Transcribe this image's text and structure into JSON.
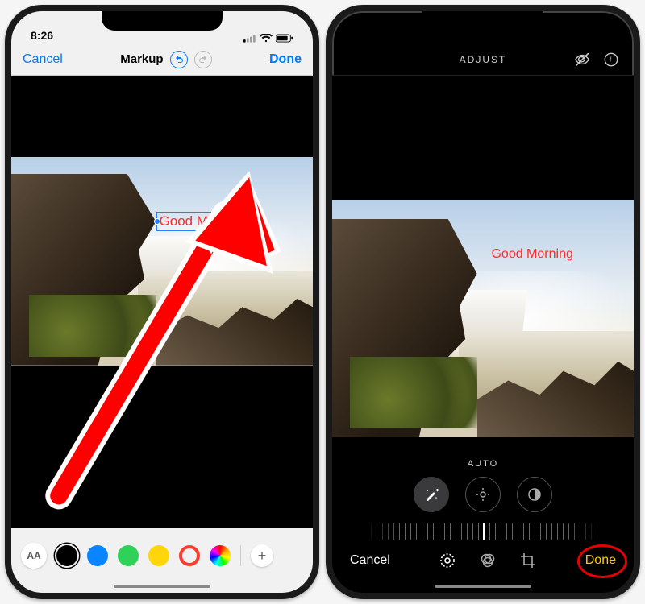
{
  "left": {
    "status": {
      "time": "8:26"
    },
    "nav": {
      "cancel": "Cancel",
      "title": "Markup",
      "done": "Done"
    },
    "text_overlay": "Good Morning",
    "palette": {
      "aa": "AA",
      "colors": [
        "#000000",
        "#0a84ff",
        "#30d158",
        "#ffd60a",
        "#ff3b30"
      ],
      "selected_index": 0,
      "plus": "+"
    }
  },
  "right": {
    "top": {
      "title": "ADJUST"
    },
    "text_overlay": "Good Morning",
    "auto_label": "AUTO",
    "bottom": {
      "cancel": "Cancel",
      "done": "Done"
    }
  }
}
